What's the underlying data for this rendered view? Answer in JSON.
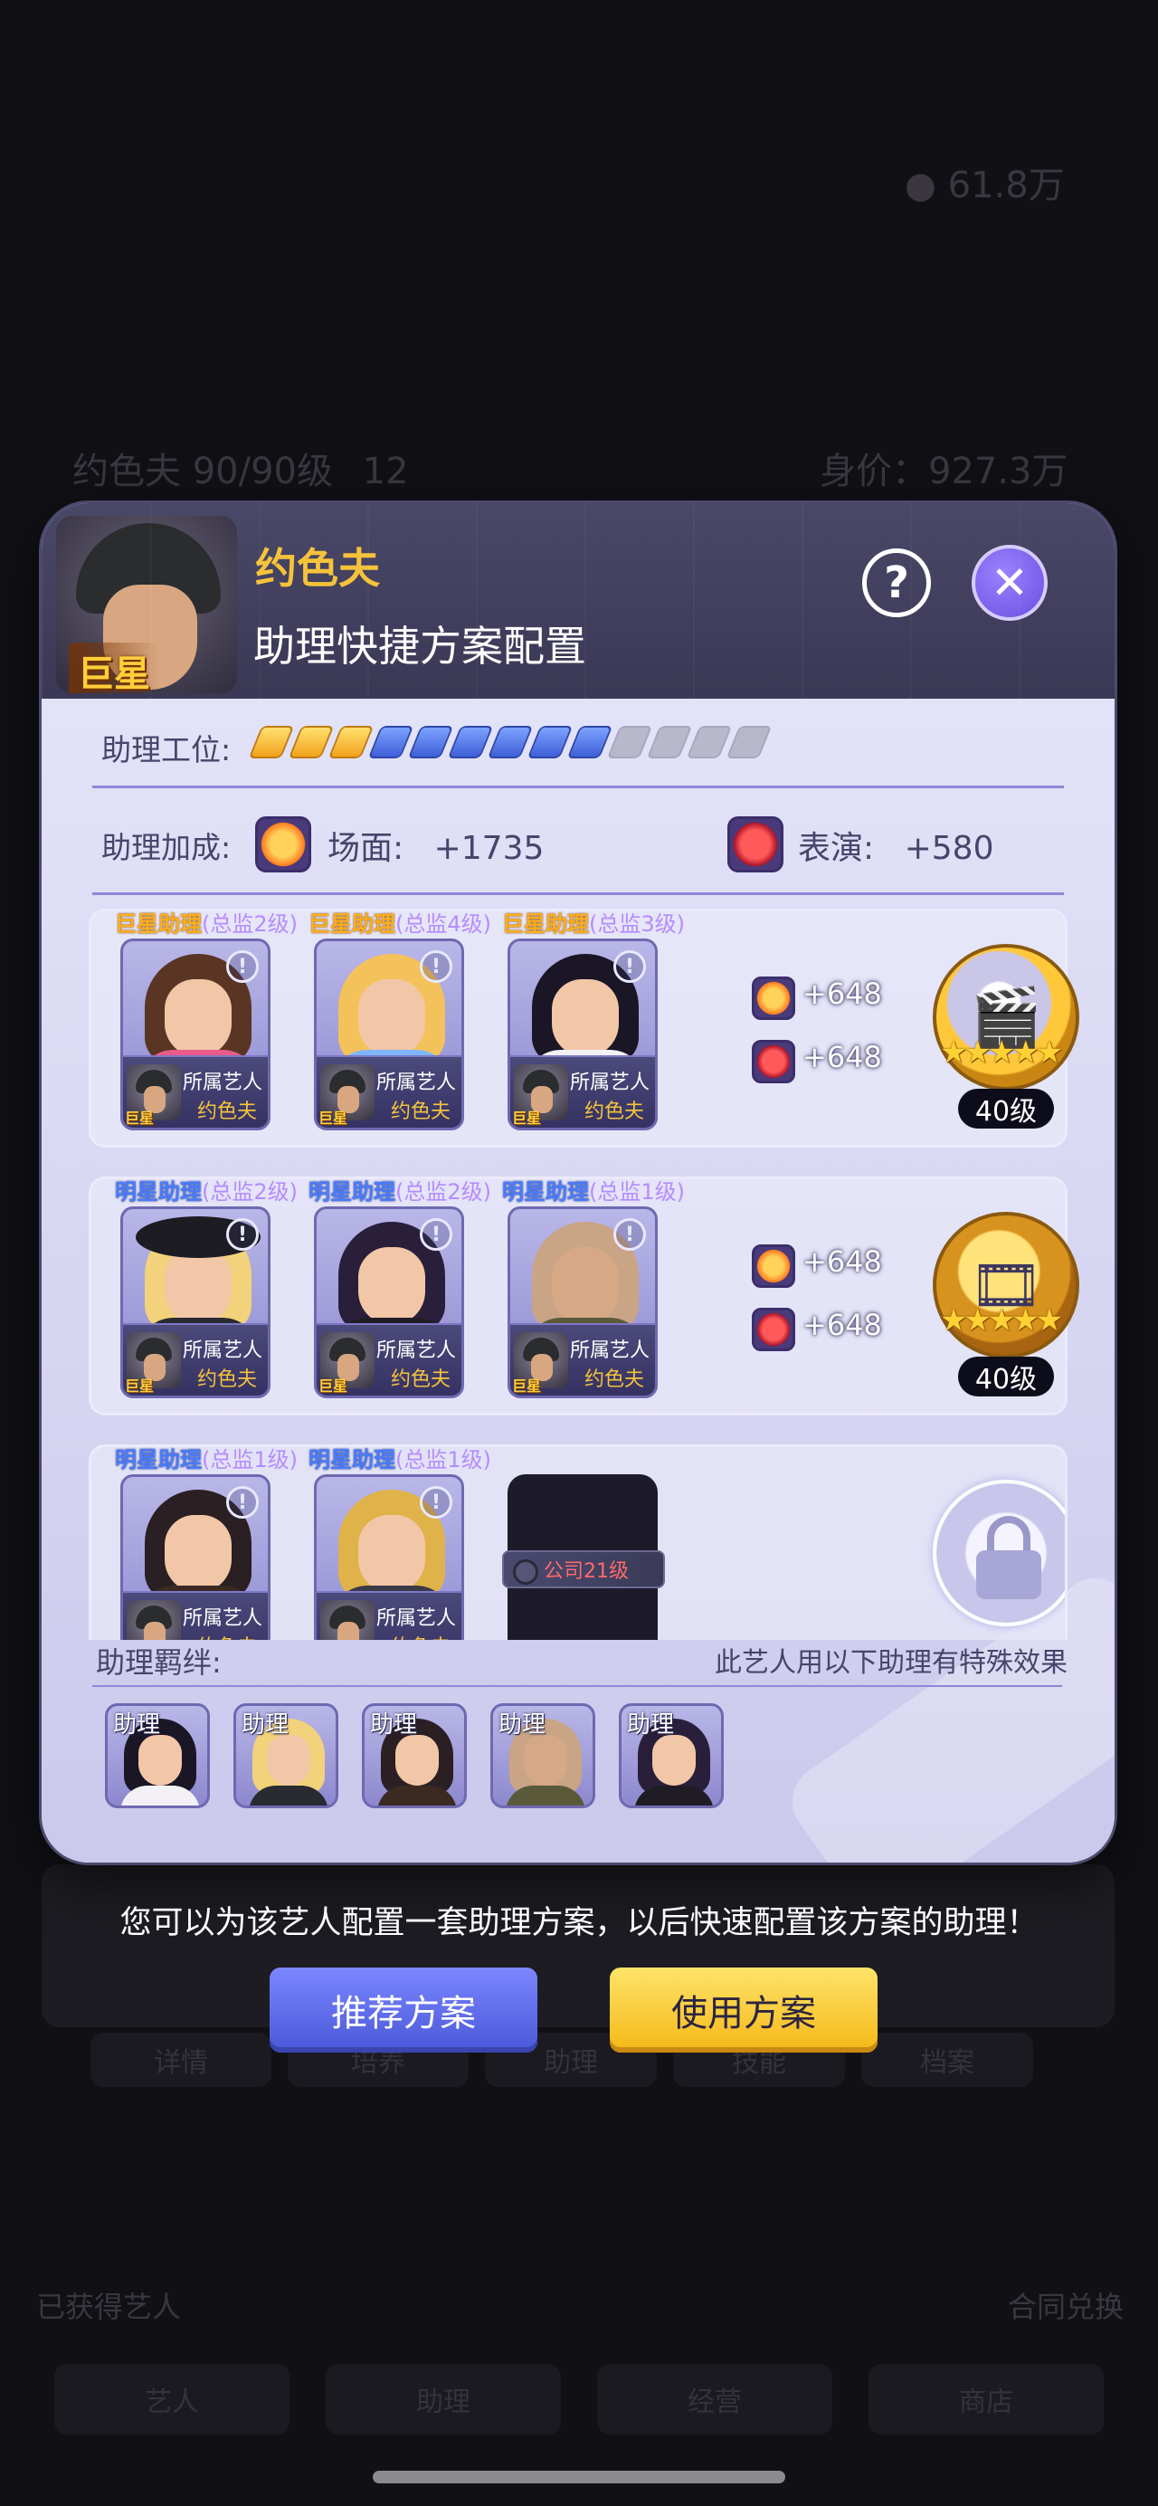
{
  "background": {
    "coins": "61.8万",
    "artist_line": "约色夫 90/90级",
    "artist_num": "12",
    "value_line": "身价：927.3万",
    "tabs": [
      "详情",
      "培养",
      "助理",
      "技能",
      "档案"
    ],
    "left_caption": "已获得艺人",
    "right_caption": "合同兑换",
    "nav": [
      "艺人",
      "助理",
      "经营",
      "商店"
    ]
  },
  "dialog": {
    "artist_name": "约色夫",
    "star_badge": "巨星",
    "title": "助理快捷方案配置",
    "help_icon": "?",
    "close_icon": "✕",
    "workstation_label": "助理工位:",
    "workstation_slots": {
      "gold": 3,
      "blue": 6,
      "gray": 4,
      "total": 13
    },
    "bonus_label": "助理加成:",
    "bonus": {
      "scene_label": "场面:",
      "scene_value": "+1735",
      "performance_label": "表演:",
      "performance_value": "+580"
    },
    "groups": [
      {
        "cards": [
          {
            "tier": "巨星助理",
            "supervisor": "(总监2级)",
            "owner_label": "所属艺人",
            "owner": "约色夫",
            "star": "巨星",
            "style": "gold"
          },
          {
            "tier": "巨星助理",
            "supervisor": "(总监4级)",
            "owner_label": "所属艺人",
            "owner": "约色夫",
            "star": "巨星",
            "style": "gold"
          },
          {
            "tier": "巨星助理",
            "supervisor": "(总监3级)",
            "owner_label": "所属艺人",
            "owner": "约色夫",
            "star": "巨星",
            "style": "gold"
          }
        ],
        "scene_bonus": "+648",
        "performance_bonus": "+648",
        "medal_level": "40级",
        "medal_stars": "★★★★★"
      },
      {
        "cards": [
          {
            "tier": "明星助理",
            "supervisor": "(总监2级)",
            "owner_label": "所属艺人",
            "owner": "约色夫",
            "star": "巨星",
            "style": "blue"
          },
          {
            "tier": "明星助理",
            "supervisor": "(总监2级)",
            "owner_label": "所属艺人",
            "owner": "约色夫",
            "star": "巨星",
            "style": "blue"
          },
          {
            "tier": "明星助理",
            "supervisor": "(总监1级)",
            "owner_label": "所属艺人",
            "owner": "约色夫",
            "star": "巨星",
            "style": "blue"
          }
        ],
        "scene_bonus": "+648",
        "performance_bonus": "+648",
        "medal_level": "40级",
        "medal_stars": "★★★★★"
      },
      {
        "cards": [
          {
            "tier": "明星助理",
            "supervisor": "(总监1级)",
            "owner_label": "所属艺人",
            "owner": "约色夫",
            "style": "blue"
          },
          {
            "tier": "明星助理",
            "supervisor": "(总监1级)",
            "owner_label": "所属艺人",
            "owner": "约色夫",
            "style": "blue"
          }
        ],
        "locked_slot_text": "公司21级"
      }
    ],
    "bond_label": "助理羁绊:",
    "bond_hint": "此艺人用以下助理有特殊效果",
    "bond_tag": "助理",
    "bond_count": 5
  },
  "bottom": {
    "hint": "您可以为该艺人配置一套助理方案，以后快速配置该方案的助理！",
    "recommend_button": "推荐方案",
    "use_button": "使用方案"
  },
  "colors": {
    "accent_gold": "#f5c33b",
    "accent_purple": "#6a4fe0",
    "button_blue": "#4a58d8",
    "button_yellow": "#f5b716"
  }
}
